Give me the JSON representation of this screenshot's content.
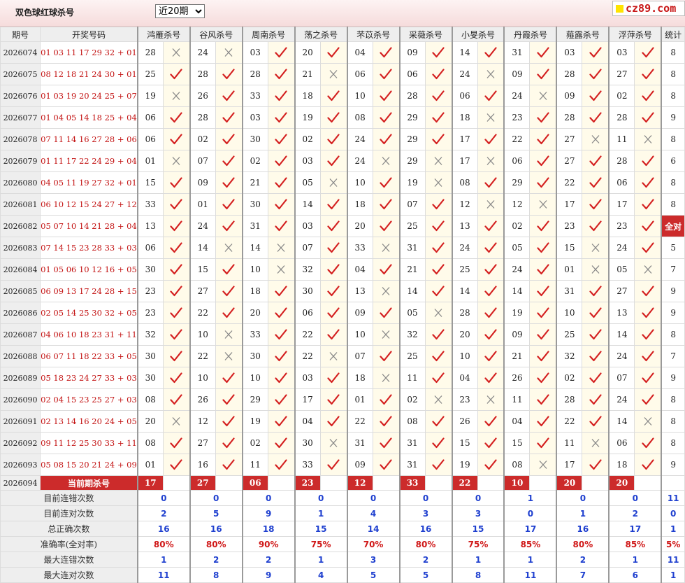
{
  "page_title": "双色球红球杀号",
  "period_select": {
    "selected": "近20期",
    "options": [
      "近20期"
    ]
  },
  "logo_text": "cz89.com",
  "headers": {
    "issue": "期号",
    "draw": "开奖号码",
    "count": "统计"
  },
  "experts": [
    "鸿雁杀号",
    "谷风杀号",
    "周南杀号",
    "荡之杀号",
    "芣苡杀号",
    "采薇杀号",
    "小旻杀号",
    "丹霞杀号",
    "薤露杀号",
    "浮萍杀号"
  ],
  "mark_colors": {
    "correct": "#d42020",
    "wrong": "#888888"
  },
  "rows": [
    {
      "issue": "2026074",
      "draw": "01 03 11 17 29 32 + 01",
      "kills": [
        "28",
        "24",
        "03",
        "20",
        "04",
        "09",
        "14",
        "31",
        "03",
        "03"
      ],
      "marks": [
        "wrong",
        "wrong",
        "correct",
        "correct",
        "correct",
        "correct",
        "correct",
        "correct",
        "correct",
        "correct"
      ],
      "count": "8"
    },
    {
      "issue": "2026075",
      "draw": "08 12 18 21 24 30 + 01",
      "kills": [
        "25",
        "28",
        "28",
        "21",
        "06",
        "06",
        "24",
        "09",
        "28",
        "27"
      ],
      "marks": [
        "correct",
        "correct",
        "correct",
        "wrong",
        "correct",
        "correct",
        "wrong",
        "correct",
        "correct",
        "correct"
      ],
      "count": "8"
    },
    {
      "issue": "2026076",
      "draw": "01 03 19 20 24 25 + 07",
      "kills": [
        "19",
        "26",
        "33",
        "18",
        "10",
        "28",
        "06",
        "24",
        "09",
        "02"
      ],
      "marks": [
        "wrong",
        "correct",
        "correct",
        "correct",
        "correct",
        "correct",
        "correct",
        "wrong",
        "correct",
        "correct"
      ],
      "count": "8"
    },
    {
      "issue": "2026077",
      "draw": "01 04 05 14 18 25 + 04",
      "kills": [
        "06",
        "28",
        "03",
        "19",
        "08",
        "29",
        "18",
        "23",
        "28",
        "28"
      ],
      "marks": [
        "correct",
        "correct",
        "correct",
        "correct",
        "correct",
        "correct",
        "wrong",
        "correct",
        "correct",
        "correct"
      ],
      "count": "9"
    },
    {
      "issue": "2026078",
      "draw": "07 11 14 16 27 28 + 06",
      "kills": [
        "06",
        "02",
        "30",
        "02",
        "24",
        "29",
        "17",
        "22",
        "27",
        "11"
      ],
      "marks": [
        "correct",
        "correct",
        "correct",
        "correct",
        "correct",
        "correct",
        "correct",
        "correct",
        "wrong",
        "wrong"
      ],
      "count": "8"
    },
    {
      "issue": "2026079",
      "draw": "01 11 17 22 24 29 + 04",
      "kills": [
        "01",
        "07",
        "02",
        "03",
        "24",
        "29",
        "17",
        "06",
        "27",
        "28"
      ],
      "marks": [
        "wrong",
        "correct",
        "correct",
        "correct",
        "wrong",
        "wrong",
        "wrong",
        "correct",
        "correct",
        "correct"
      ],
      "count": "6"
    },
    {
      "issue": "2026080",
      "draw": "04 05 11 19 27 32 + 01",
      "kills": [
        "15",
        "09",
        "21",
        "05",
        "10",
        "19",
        "08",
        "29",
        "22",
        "06"
      ],
      "marks": [
        "correct",
        "correct",
        "correct",
        "wrong",
        "correct",
        "wrong",
        "correct",
        "correct",
        "correct",
        "correct"
      ],
      "count": "8"
    },
    {
      "issue": "2026081",
      "draw": "06 10 12 15 24 27 + 12",
      "kills": [
        "33",
        "01",
        "30",
        "14",
        "18",
        "07",
        "12",
        "12",
        "17",
        "17"
      ],
      "marks": [
        "correct",
        "correct",
        "correct",
        "correct",
        "correct",
        "correct",
        "wrong",
        "wrong",
        "correct",
        "correct"
      ],
      "count": "8"
    },
    {
      "issue": "2026082",
      "draw": "05 07 10 14 21 28 + 04",
      "kills": [
        "13",
        "24",
        "31",
        "03",
        "20",
        "25",
        "13",
        "02",
        "23",
        "23"
      ],
      "marks": [
        "correct",
        "correct",
        "correct",
        "correct",
        "correct",
        "correct",
        "correct",
        "correct",
        "correct",
        "correct"
      ],
      "count": "全对"
    },
    {
      "issue": "2026083",
      "draw": "07 14 15 23 28 33 + 03",
      "kills": [
        "06",
        "14",
        "14",
        "07",
        "33",
        "31",
        "24",
        "05",
        "15",
        "24"
      ],
      "marks": [
        "correct",
        "wrong",
        "wrong",
        "correct",
        "wrong",
        "correct",
        "correct",
        "correct",
        "wrong",
        "correct"
      ],
      "count": "5"
    },
    {
      "issue": "2026084",
      "draw": "01 05 06 10 12 16 + 05",
      "kills": [
        "30",
        "15",
        "10",
        "32",
        "04",
        "21",
        "25",
        "24",
        "01",
        "05"
      ],
      "marks": [
        "correct",
        "correct",
        "wrong",
        "correct",
        "correct",
        "correct",
        "correct",
        "correct",
        "wrong",
        "wrong"
      ],
      "count": "7"
    },
    {
      "issue": "2026085",
      "draw": "06 09 13 17 24 28 + 15",
      "kills": [
        "23",
        "27",
        "18",
        "30",
        "13",
        "14",
        "14",
        "14",
        "31",
        "27"
      ],
      "marks": [
        "correct",
        "correct",
        "correct",
        "correct",
        "wrong",
        "correct",
        "correct",
        "correct",
        "correct",
        "correct"
      ],
      "count": "9"
    },
    {
      "issue": "2026086",
      "draw": "02 05 14 25 30 32 + 05",
      "kills": [
        "23",
        "22",
        "20",
        "06",
        "09",
        "05",
        "28",
        "19",
        "10",
        "13"
      ],
      "marks": [
        "correct",
        "correct",
        "correct",
        "correct",
        "correct",
        "wrong",
        "correct",
        "correct",
        "correct",
        "correct"
      ],
      "count": "9"
    },
    {
      "issue": "2026087",
      "draw": "04 06 10 18 23 31 + 11",
      "kills": [
        "32",
        "10",
        "33",
        "22",
        "10",
        "32",
        "20",
        "09",
        "25",
        "14"
      ],
      "marks": [
        "correct",
        "wrong",
        "correct",
        "correct",
        "wrong",
        "correct",
        "correct",
        "correct",
        "correct",
        "correct"
      ],
      "count": "8"
    },
    {
      "issue": "2026088",
      "draw": "06 07 11 18 22 33 + 05",
      "kills": [
        "30",
        "22",
        "30",
        "22",
        "07",
        "25",
        "10",
        "21",
        "32",
        "24"
      ],
      "marks": [
        "correct",
        "wrong",
        "correct",
        "wrong",
        "correct",
        "correct",
        "correct",
        "correct",
        "correct",
        "correct"
      ],
      "count": "7"
    },
    {
      "issue": "2026089",
      "draw": "05 18 23 24 27 33 + 03",
      "kills": [
        "30",
        "10",
        "10",
        "03",
        "18",
        "11",
        "04",
        "26",
        "02",
        "07"
      ],
      "marks": [
        "correct",
        "correct",
        "correct",
        "correct",
        "wrong",
        "correct",
        "correct",
        "correct",
        "correct",
        "correct"
      ],
      "count": "9"
    },
    {
      "issue": "2026090",
      "draw": "02 04 15 23 25 27 + 03",
      "kills": [
        "08",
        "26",
        "29",
        "17",
        "01",
        "02",
        "23",
        "11",
        "28",
        "24"
      ],
      "marks": [
        "correct",
        "correct",
        "correct",
        "correct",
        "correct",
        "wrong",
        "wrong",
        "correct",
        "correct",
        "correct"
      ],
      "count": "8"
    },
    {
      "issue": "2026091",
      "draw": "02 13 14 16 20 24 + 05",
      "kills": [
        "20",
        "12",
        "19",
        "04",
        "22",
        "08",
        "26",
        "04",
        "22",
        "14"
      ],
      "marks": [
        "wrong",
        "correct",
        "correct",
        "correct",
        "correct",
        "correct",
        "correct",
        "correct",
        "correct",
        "wrong"
      ],
      "count": "8"
    },
    {
      "issue": "2026092",
      "draw": "09 11 12 25 30 33 + 11",
      "kills": [
        "08",
        "27",
        "02",
        "30",
        "31",
        "31",
        "15",
        "15",
        "11",
        "06"
      ],
      "marks": [
        "correct",
        "correct",
        "correct",
        "wrong",
        "correct",
        "correct",
        "correct",
        "correct",
        "wrong",
        "correct"
      ],
      "count": "8"
    },
    {
      "issue": "2026093",
      "draw": "05 08 15 20 21 24 + 09",
      "kills": [
        "01",
        "16",
        "11",
        "33",
        "09",
        "31",
        "19",
        "08",
        "17",
        "18"
      ],
      "marks": [
        "correct",
        "correct",
        "correct",
        "correct",
        "correct",
        "correct",
        "correct",
        "wrong",
        "correct",
        "correct"
      ],
      "count": "9"
    }
  ],
  "current": {
    "issue": "2026094",
    "label": "当前期杀号",
    "kills": [
      "17",
      "27",
      "06",
      "23",
      "12",
      "33",
      "22",
      "10",
      "20",
      "20"
    ]
  },
  "stats": [
    {
      "label": "目前连错次数",
      "values": [
        "0",
        "0",
        "0",
        "0",
        "0",
        "0",
        "0",
        "1",
        "0",
        "0"
      ],
      "count": "11",
      "color": "blue"
    },
    {
      "label": "目前连对次数",
      "values": [
        "2",
        "5",
        "9",
        "1",
        "4",
        "3",
        "3",
        "0",
        "1",
        "2"
      ],
      "count": "0",
      "color": "blue"
    },
    {
      "label": "总正确次数",
      "values": [
        "16",
        "16",
        "18",
        "15",
        "14",
        "16",
        "15",
        "17",
        "16",
        "17"
      ],
      "count": "1",
      "color": "blue"
    },
    {
      "label": "准确率(全对率)",
      "values": [
        "80%",
        "80%",
        "90%",
        "75%",
        "70%",
        "80%",
        "75%",
        "85%",
        "80%",
        "85%"
      ],
      "count": "5%",
      "color": "red"
    },
    {
      "label": "最大连错次数",
      "values": [
        "1",
        "2",
        "2",
        "1",
        "3",
        "2",
        "1",
        "1",
        "2",
        "1"
      ],
      "count": "11",
      "color": "blue"
    },
    {
      "label": "最大连对次数",
      "values": [
        "11",
        "8",
        "9",
        "4",
        "5",
        "5",
        "8",
        "11",
        "7",
        "6"
      ],
      "count": "1",
      "color": "blue"
    }
  ]
}
